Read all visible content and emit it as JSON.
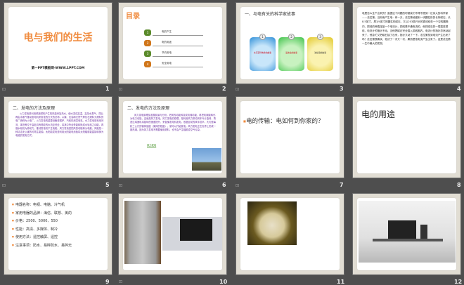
{
  "slides": [
    {
      "number": "1",
      "title": "电与我们的生活",
      "subtitle": "第一PPT模板网-WWW.1PPT.COM"
    },
    {
      "number": "2",
      "title": "目录",
      "items": [
        {
          "n": "1",
          "label": "电的产生"
        },
        {
          "n": "2",
          "label": "电的用途"
        },
        {
          "n": "3",
          "label": "节约用电"
        },
        {
          "n": "4",
          "label": "安全用电"
        }
      ]
    },
    {
      "number": "3",
      "title": "一、与电有关的科学家故事",
      "cards": [
        {
          "n": "1",
          "label": "文天富特电池的故事"
        },
        {
          "n": "2",
          "label": "爱迪生的故事"
        },
        {
          "n": "3",
          "label": "法拉第的故事"
        }
      ]
    },
    {
      "number": "4",
      "text": "电是怎么生产出来的？面提这个问题的时候我们不得不提到一位伟大的科学家——法拉第。当用而产生电：有一天，法拉第他做到一块圆柱形的长条磁石，长8.5英寸，厚3/4英寸的圆柱形磁石，又以203英尺长的铜线绕在一个空的圆筒内，铜线的两端连接一个电流计，铜线是不通电流的。他将磁石的一端插进铜线，电流计的指针不动。当他把磁石完全插入铜线圈内，电流计的指针忽然动起来了，他急忙又把磁石抽了出来，指针又动了一下。法拉第找到电流产生出来了吗？法拉第很喜欢，他试了一次又一次，果然是他电流产生出来了。这是法拉第一生中最大的发现。"
    },
    {
      "number": "5",
      "title": "二、发电的方法及原理",
      "text": "火力发电是利用燃烧燃料产生的热能来加热水，使水变成高温、高压水蒸气，然后再由水蒸气推动发电机来发电的方式的总称。以煤、石油和天然气等化石燃料为燃料的电厂统称为火电厂。火力发电的重要设备是锅炉、汽轮机和发电机。水力发电是利用河流、湖泊等位于高处具有势能的水流至低处，将其中所含势能转换成水轮机之动能，再借水轮机为原动力，推动发电机产生电能。风力发电是把风的动能转为电能，风能是一种清洁无公害的可再生能源。太阳能发电是利用太阳能电池板将太阳辐射能直接转换为电能的发电方式。"
    },
    {
      "number": "6",
      "title": "二、发电的方法及原理",
      "text": "风力发电原理及发展前景与分析。把风的动能转变成机械动能，再把机械能转化为电力动能，这就是风力发电。风力发电的原理，是利用风力带动风车叶片旋转，再透过增速机将旋转的速度提升，来促使发电机发电。依据目前的风车技术，大约是每秒三公尺的微风速度（微风的程度），便可以开始发电。风力发电正在世界上形成一股热潮，因为风力发电不需要使用燃料，也不会产生辐射或空气污染。",
      "link": "风力发电"
    },
    {
      "number": "7",
      "bullet": "电的传输：电如何到你家的？"
    },
    {
      "number": "8",
      "title": "电的用途"
    },
    {
      "number": "9",
      "bullets": [
        "电器名称：电视、电脑、冷气机",
        "家用电器的品牌：海信、联想、美的",
        "价格：2500、5000、550",
        "性能：高清、多媒体、制冷",
        "使用方法：遥控触屏、遥控",
        "注意事项：防水、易碎防水、易碎无"
      ]
    },
    {
      "number": "10"
    },
    {
      "number": "11"
    },
    {
      "number": "12"
    }
  ],
  "colors": {
    "orange": "#f08a3c",
    "green": "#5a8a2a",
    "bg": "#4e4e4e"
  }
}
